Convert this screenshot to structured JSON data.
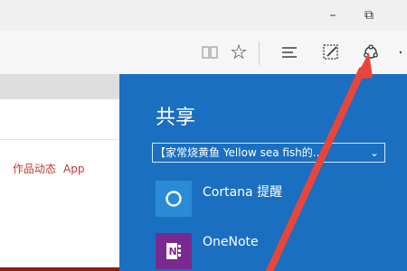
{
  "window": {
    "minimize_glyph": "–",
    "restore_glyph": "⧉"
  },
  "toolbar": {
    "icons": [
      "reading-view-icon",
      "favorites-star-icon",
      "hub-icon",
      "web-note-icon",
      "share-icon",
      "more-icon"
    ]
  },
  "page": {
    "nav_links": [
      "作品动态",
      "App"
    ]
  },
  "share": {
    "title": "共享",
    "source_select": "【家常烧黄鱼 Yellow sea fish的...",
    "targets": [
      {
        "label": "Cortana 提醒",
        "icon": "cortana-icon"
      },
      {
        "label": "OneNote",
        "icon": "onenote-icon"
      }
    ]
  },
  "colors": {
    "share_pane": "#1a6fc0",
    "pointer_arrow": "#e8463a"
  }
}
